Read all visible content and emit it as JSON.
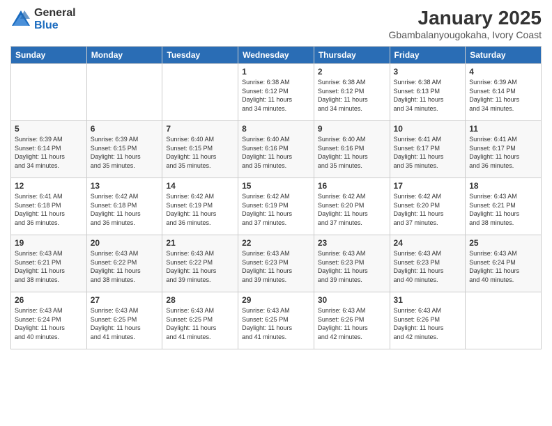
{
  "header": {
    "logo": {
      "general": "General",
      "blue": "Blue"
    },
    "title": "January 2025",
    "location": "Gbambalanyougokaha, Ivory Coast"
  },
  "days_of_week": [
    "Sunday",
    "Monday",
    "Tuesday",
    "Wednesday",
    "Thursday",
    "Friday",
    "Saturday"
  ],
  "weeks": [
    [
      {
        "day": "",
        "info": ""
      },
      {
        "day": "",
        "info": ""
      },
      {
        "day": "",
        "info": ""
      },
      {
        "day": "1",
        "info": "Sunrise: 6:38 AM\nSunset: 6:12 PM\nDaylight: 11 hours\nand 34 minutes."
      },
      {
        "day": "2",
        "info": "Sunrise: 6:38 AM\nSunset: 6:12 PM\nDaylight: 11 hours\nand 34 minutes."
      },
      {
        "day": "3",
        "info": "Sunrise: 6:38 AM\nSunset: 6:13 PM\nDaylight: 11 hours\nand 34 minutes."
      },
      {
        "day": "4",
        "info": "Sunrise: 6:39 AM\nSunset: 6:14 PM\nDaylight: 11 hours\nand 34 minutes."
      }
    ],
    [
      {
        "day": "5",
        "info": "Sunrise: 6:39 AM\nSunset: 6:14 PM\nDaylight: 11 hours\nand 34 minutes."
      },
      {
        "day": "6",
        "info": "Sunrise: 6:39 AM\nSunset: 6:15 PM\nDaylight: 11 hours\nand 35 minutes."
      },
      {
        "day": "7",
        "info": "Sunrise: 6:40 AM\nSunset: 6:15 PM\nDaylight: 11 hours\nand 35 minutes."
      },
      {
        "day": "8",
        "info": "Sunrise: 6:40 AM\nSunset: 6:16 PM\nDaylight: 11 hours\nand 35 minutes."
      },
      {
        "day": "9",
        "info": "Sunrise: 6:40 AM\nSunset: 6:16 PM\nDaylight: 11 hours\nand 35 minutes."
      },
      {
        "day": "10",
        "info": "Sunrise: 6:41 AM\nSunset: 6:17 PM\nDaylight: 11 hours\nand 35 minutes."
      },
      {
        "day": "11",
        "info": "Sunrise: 6:41 AM\nSunset: 6:17 PM\nDaylight: 11 hours\nand 36 minutes."
      }
    ],
    [
      {
        "day": "12",
        "info": "Sunrise: 6:41 AM\nSunset: 6:18 PM\nDaylight: 11 hours\nand 36 minutes."
      },
      {
        "day": "13",
        "info": "Sunrise: 6:42 AM\nSunset: 6:18 PM\nDaylight: 11 hours\nand 36 minutes."
      },
      {
        "day": "14",
        "info": "Sunrise: 6:42 AM\nSunset: 6:19 PM\nDaylight: 11 hours\nand 36 minutes."
      },
      {
        "day": "15",
        "info": "Sunrise: 6:42 AM\nSunset: 6:19 PM\nDaylight: 11 hours\nand 37 minutes."
      },
      {
        "day": "16",
        "info": "Sunrise: 6:42 AM\nSunset: 6:20 PM\nDaylight: 11 hours\nand 37 minutes."
      },
      {
        "day": "17",
        "info": "Sunrise: 6:42 AM\nSunset: 6:20 PM\nDaylight: 11 hours\nand 37 minutes."
      },
      {
        "day": "18",
        "info": "Sunrise: 6:43 AM\nSunset: 6:21 PM\nDaylight: 11 hours\nand 38 minutes."
      }
    ],
    [
      {
        "day": "19",
        "info": "Sunrise: 6:43 AM\nSunset: 6:21 PM\nDaylight: 11 hours\nand 38 minutes."
      },
      {
        "day": "20",
        "info": "Sunrise: 6:43 AM\nSunset: 6:22 PM\nDaylight: 11 hours\nand 38 minutes."
      },
      {
        "day": "21",
        "info": "Sunrise: 6:43 AM\nSunset: 6:22 PM\nDaylight: 11 hours\nand 39 minutes."
      },
      {
        "day": "22",
        "info": "Sunrise: 6:43 AM\nSunset: 6:23 PM\nDaylight: 11 hours\nand 39 minutes."
      },
      {
        "day": "23",
        "info": "Sunrise: 6:43 AM\nSunset: 6:23 PM\nDaylight: 11 hours\nand 39 minutes."
      },
      {
        "day": "24",
        "info": "Sunrise: 6:43 AM\nSunset: 6:23 PM\nDaylight: 11 hours\nand 40 minutes."
      },
      {
        "day": "25",
        "info": "Sunrise: 6:43 AM\nSunset: 6:24 PM\nDaylight: 11 hours\nand 40 minutes."
      }
    ],
    [
      {
        "day": "26",
        "info": "Sunrise: 6:43 AM\nSunset: 6:24 PM\nDaylight: 11 hours\nand 40 minutes."
      },
      {
        "day": "27",
        "info": "Sunrise: 6:43 AM\nSunset: 6:25 PM\nDaylight: 11 hours\nand 41 minutes."
      },
      {
        "day": "28",
        "info": "Sunrise: 6:43 AM\nSunset: 6:25 PM\nDaylight: 11 hours\nand 41 minutes."
      },
      {
        "day": "29",
        "info": "Sunrise: 6:43 AM\nSunset: 6:25 PM\nDaylight: 11 hours\nand 41 minutes."
      },
      {
        "day": "30",
        "info": "Sunrise: 6:43 AM\nSunset: 6:26 PM\nDaylight: 11 hours\nand 42 minutes."
      },
      {
        "day": "31",
        "info": "Sunrise: 6:43 AM\nSunset: 6:26 PM\nDaylight: 11 hours\nand 42 minutes."
      },
      {
        "day": "",
        "info": ""
      }
    ]
  ]
}
